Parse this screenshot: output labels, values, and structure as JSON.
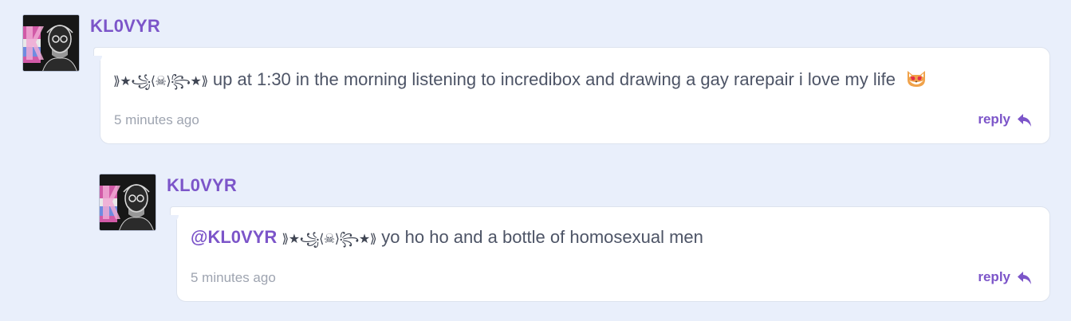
{
  "comments": [
    {
      "username": "KL0VYR",
      "decoration": "⟫★꧁⟨☠⟩꧂★⟫",
      "mention": "",
      "text": "up at 1:30 in the morning listening to incredibox and drawing a gay rarepair i love my life",
      "emoji": "heart-eyes-cat-icon",
      "time": "5 minutes ago",
      "reply_label": "reply"
    },
    {
      "username": "KL0VYR",
      "decoration": "⟫★꧁⟨☠⟩꧂★⟫",
      "mention": "@KL0VYR",
      "text": "yo ho ho and a bottle of homosexual men",
      "time": "5 minutes ago",
      "reply_label": "reply"
    }
  ],
  "colors": {
    "background": "#e9effb",
    "accent": "#7c55c9",
    "text": "#4d5466",
    "muted": "#9ea4b0"
  }
}
